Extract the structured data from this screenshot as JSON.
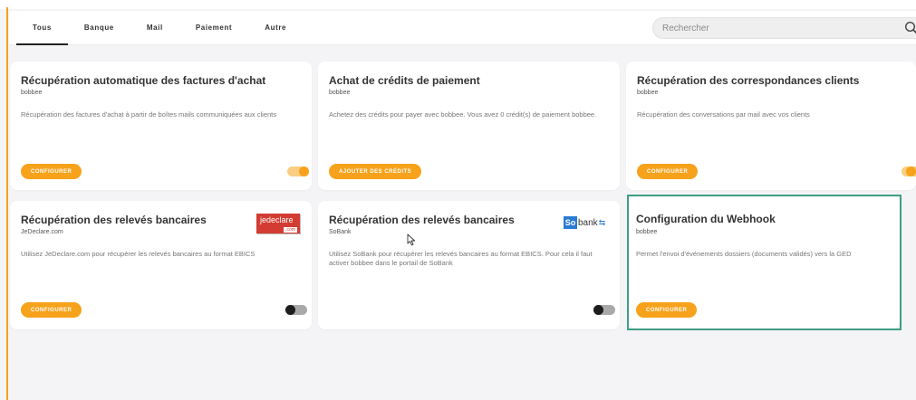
{
  "filters": {
    "tabs": [
      {
        "label": "Tous",
        "active": true
      },
      {
        "label": "Banque",
        "active": false
      },
      {
        "label": "Mail",
        "active": false
      },
      {
        "label": "Paiement",
        "active": false
      },
      {
        "label": "Autre",
        "active": false
      }
    ]
  },
  "search": {
    "placeholder": "Rechercher",
    "icon": "search-icon"
  },
  "cards": [
    {
      "title": "Récupération automatique des factures d'achat",
      "subtitle": "bobbee",
      "description": "Récupération des factures d'achat à partir de boîtes mails communiquées aux clients",
      "button_label": "CONFIGURER",
      "toggle": "on"
    },
    {
      "title": "Achat de crédits de paiement",
      "subtitle": "bobbee",
      "description": "Achetez des crédits pour payer avec bobbee. Vous avez 0 crédit(s) de paiement bobbee.",
      "button_label": "AJOUTER DES CRÉDITS"
    },
    {
      "title": "Récupération des correspondances clients",
      "subtitle": "bobbee",
      "description": "Récupération des conversations par mail avec vos clients",
      "button_label": "CONFIGURER",
      "toggle": "on"
    },
    {
      "title": "Récupération des relevés bancaires",
      "subtitle": "JeDeclare.com",
      "description": "Utilisez JeDeclare.com pour récupérer les relevés bancaires au format EBICS",
      "button_label": "CONFIGURER",
      "toggle": "off",
      "logo": {
        "main": "jedeclare",
        "suffix": ".com"
      }
    },
    {
      "title": "Récupération des relevés bancaires",
      "subtitle": "SoBank",
      "description": "Utilisez SoBank pour récupérer les relevés bancaires au format EBICS. Pour cela il faut activer bobbee dans le portail de SoBank",
      "button_label": "CONFIGURER",
      "toggle": "off",
      "logo": {
        "so": "So",
        "bank": "bank"
      }
    },
    {
      "title": "Configuration du Webhook",
      "subtitle": "bobbee",
      "description": "Permet l'envoi d'événements dossiers (documents validés) vers la GED",
      "button_label": "CONFIGURER"
    }
  ],
  "colors": {
    "accent": "#f7a21b",
    "highlight": "#3f9e84",
    "background": "#f4f4f6"
  }
}
